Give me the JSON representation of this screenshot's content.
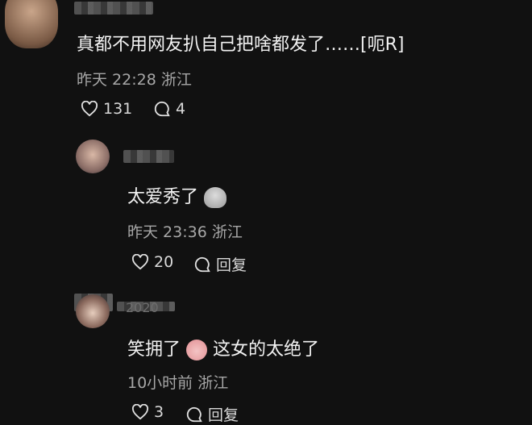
{
  "c1": {
    "text": "真都不用网友扒自己把啥都发了……[呃R]",
    "meta": "昨天 22:28 浙江",
    "likes": "131",
    "replies": "4"
  },
  "c2": {
    "text": "太爱秀了",
    "meta": "昨天 23:36 浙江",
    "likes": "20",
    "reply_label": "回复"
  },
  "c3": {
    "name": "2020",
    "text_before": "笑拥了",
    "text_after": "这女的太绝了",
    "meta": "10小时前 浙江",
    "likes": "3",
    "reply_label": "回复"
  }
}
